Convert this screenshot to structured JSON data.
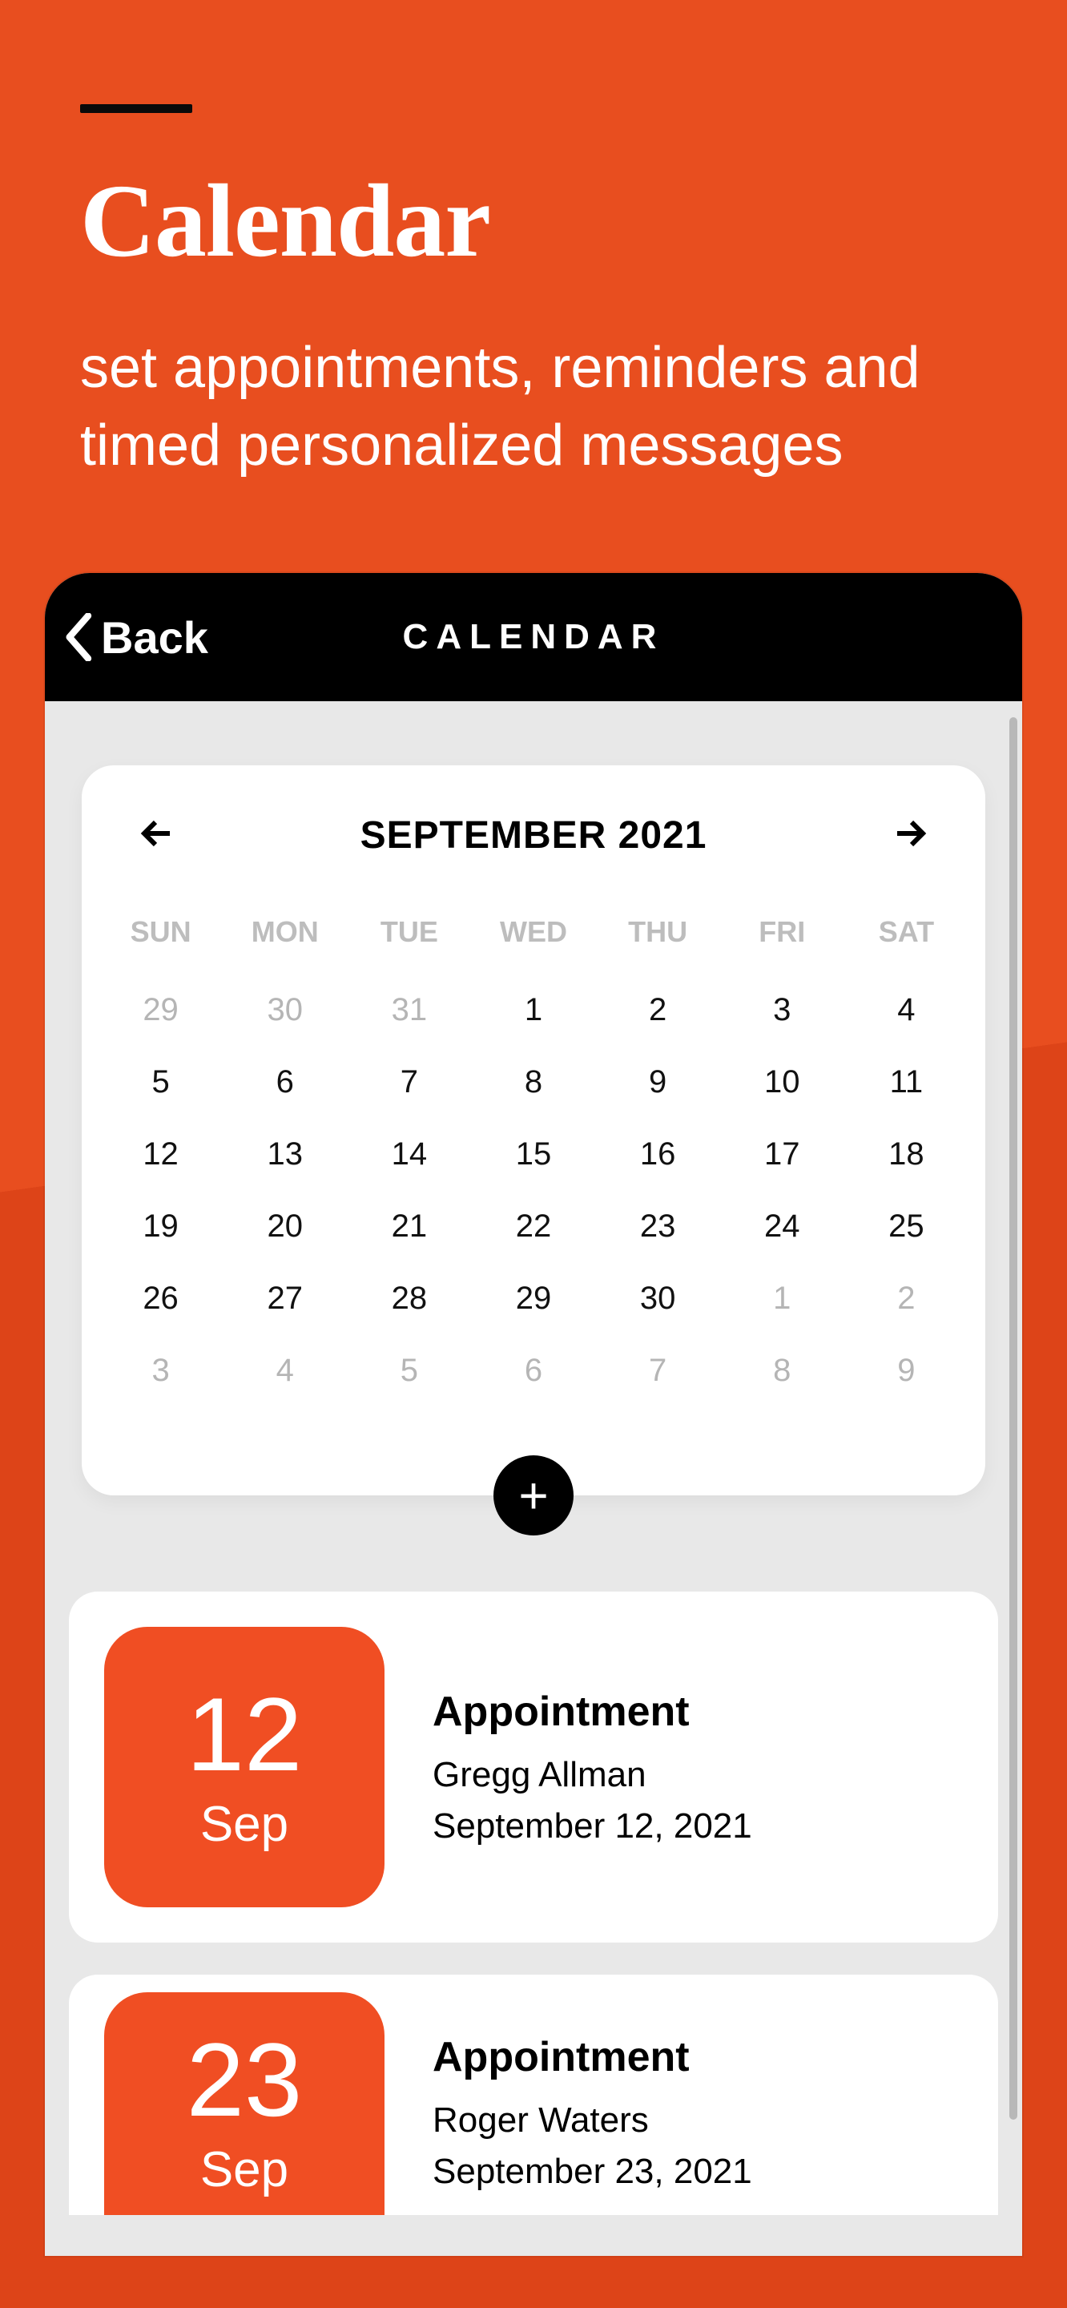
{
  "hero": {
    "title": "Calendar",
    "subtitle": "set appointments, reminders and timed personalized messages"
  },
  "topbar": {
    "back_label": "Back",
    "title": "CALENDAR"
  },
  "calendar": {
    "month_label": "SEPTEMBER 2021",
    "day_headers": [
      "SUN",
      "MON",
      "TUE",
      "WED",
      "THU",
      "FRI",
      "SAT"
    ],
    "weeks": [
      [
        {
          "n": "29",
          "dim": true
        },
        {
          "n": "30",
          "dim": true
        },
        {
          "n": "31",
          "dim": true
        },
        {
          "n": "1"
        },
        {
          "n": "2"
        },
        {
          "n": "3"
        },
        {
          "n": "4"
        }
      ],
      [
        {
          "n": "5"
        },
        {
          "n": "6"
        },
        {
          "n": "7"
        },
        {
          "n": "8"
        },
        {
          "n": "9"
        },
        {
          "n": "10"
        },
        {
          "n": "11"
        }
      ],
      [
        {
          "n": "12"
        },
        {
          "n": "13"
        },
        {
          "n": "14"
        },
        {
          "n": "15"
        },
        {
          "n": "16"
        },
        {
          "n": "17"
        },
        {
          "n": "18"
        }
      ],
      [
        {
          "n": "19"
        },
        {
          "n": "20"
        },
        {
          "n": "21"
        },
        {
          "n": "22"
        },
        {
          "n": "23"
        },
        {
          "n": "24"
        },
        {
          "n": "25"
        }
      ],
      [
        {
          "n": "26"
        },
        {
          "n": "27"
        },
        {
          "n": "28"
        },
        {
          "n": "29"
        },
        {
          "n": "30"
        },
        {
          "n": "1",
          "dim": true
        },
        {
          "n": "2",
          "dim": true
        }
      ],
      [
        {
          "n": "3",
          "dim": true
        },
        {
          "n": "4",
          "dim": true
        },
        {
          "n": "5",
          "dim": true
        },
        {
          "n": "6",
          "dim": true
        },
        {
          "n": "7",
          "dim": true
        },
        {
          "n": "8",
          "dim": true
        },
        {
          "n": "9",
          "dim": true
        }
      ]
    ],
    "add_label": "+"
  },
  "events": [
    {
      "day": "12",
      "month": "Sep",
      "type": "Appointment",
      "person": "Gregg Allman",
      "date": "September 12, 2021"
    },
    {
      "day": "23",
      "month": "Sep",
      "type": "Appointment",
      "person": "Roger Waters",
      "date": "September 23, 2021"
    }
  ]
}
